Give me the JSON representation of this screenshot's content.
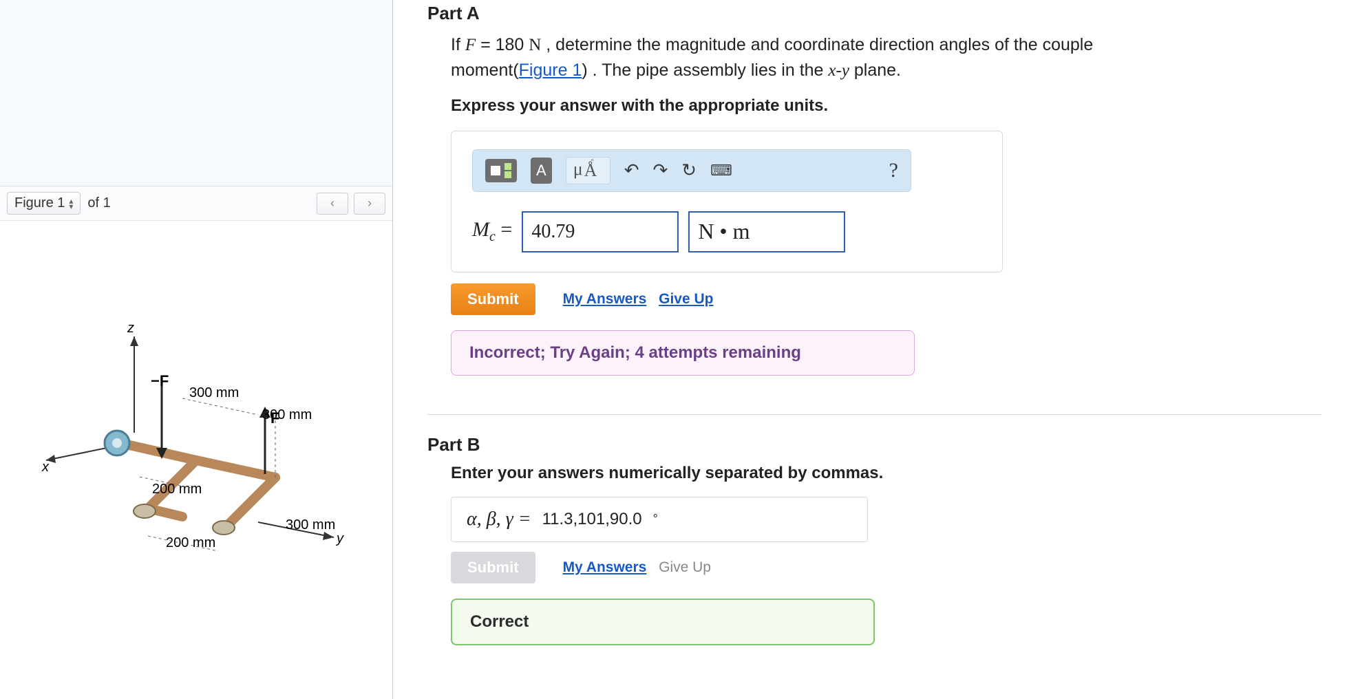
{
  "figure": {
    "label": "Figure 1",
    "of_text": "of 1",
    "placeholder": "[ pipe assembly diagram ]",
    "dims": {
      "d300a": "300 mm",
      "d300b": "300 mm",
      "d300c": "300 mm",
      "d200a": "200 mm",
      "d200b": "200 mm",
      "Fneg": "−F",
      "Fpos": "F",
      "ax_x": "x",
      "ax_y": "y",
      "ax_z": "z"
    }
  },
  "partA": {
    "title": "Part A",
    "prompt_pre": "If ",
    "prompt_F": "F",
    "prompt_eq": " = 180 ",
    "prompt_N": "N",
    "prompt_mid": " , determine the magnitude and coordinate direction angles of the couple moment(",
    "prompt_link": "Figure 1",
    "prompt_post": ") . The pipe assembly lies in the ",
    "prompt_xy": "x-y",
    "prompt_end": " plane.",
    "instruction": "Express your answer with the appropriate units.",
    "toolbar": {
      "uA": "μÅ",
      "help": "?"
    },
    "mc_label": "M",
    "mc_sub": "c",
    "mc_eq": " = ",
    "value": "40.79",
    "units": "N • m",
    "submit": "Submit",
    "my_answers": "My Answers",
    "give_up": "Give Up",
    "feedback": "Incorrect; Try Again; 4 attempts remaining"
  },
  "partB": {
    "title": "Part B",
    "instruction": "Enter your answers numerically separated by commas.",
    "label": "α, β, γ = ",
    "value": "11.3,101,90.0",
    "deg": "°",
    "submit": "Submit",
    "my_answers": "My Answers",
    "give_up": "Give Up",
    "feedback": "Correct"
  }
}
